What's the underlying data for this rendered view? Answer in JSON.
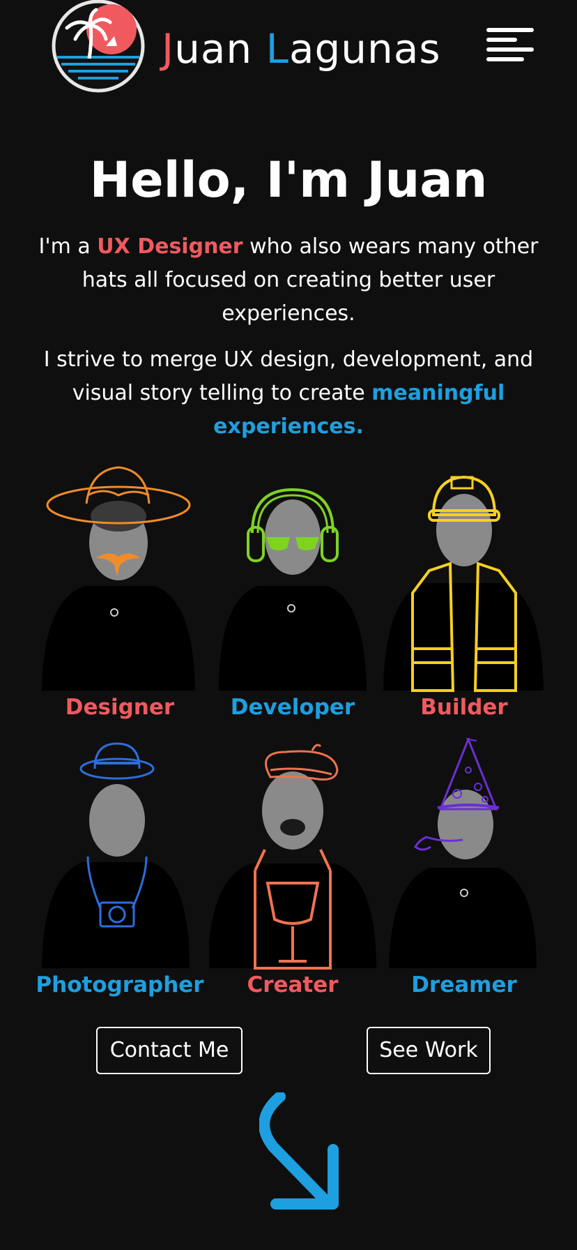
{
  "header": {
    "brand_first_initial": "J",
    "brand_first_rest": "uan",
    "brand_last_initial": "L",
    "brand_last_rest": "agunas",
    "logo_icon": "palm-tree-sunset-logo",
    "menu_icon": "hamburger-menu-icon"
  },
  "hero": {
    "title": "Hello, I'm Juan",
    "p1_before": "I'm a ",
    "p1_highlight": "UX Designer",
    "p1_after": " who also wears many other hats all focused on creating better user experiences.",
    "p2_before": "I strive to merge UX design, development, and visual story telling to create ",
    "p2_highlight": "meaningful experiences."
  },
  "roles": [
    {
      "label": "Designer",
      "color": "#f05a5f",
      "accent": "#f28c28",
      "icon": "sombrero-mustache"
    },
    {
      "label": "Developer",
      "color": "#1e9fe0",
      "accent": "#7ed321",
      "icon": "headphones-sunglasses"
    },
    {
      "label": "Builder",
      "color": "#f05a5f",
      "accent": "#f5d020",
      "icon": "hardhat-vest"
    },
    {
      "label": "Photographer",
      "color": "#1e9fe0",
      "accent": "#2b6fdc",
      "icon": "fedora-camera"
    },
    {
      "label": "Creater",
      "color": "#f05a5f",
      "accent": "#f0734f",
      "icon": "beret-overalls"
    },
    {
      "label": "Dreamer",
      "color": "#1e9fe0",
      "accent": "#6a2fd6",
      "icon": "party-hat-blower"
    }
  ],
  "actions": {
    "contact_label": "Contact Me",
    "work_label": "See Work"
  },
  "colors": {
    "background": "#0f0f0f",
    "red": "#f05a5f",
    "blue": "#1e9fe0"
  },
  "scroll_icon": "curved-arrow-down-right-icon"
}
